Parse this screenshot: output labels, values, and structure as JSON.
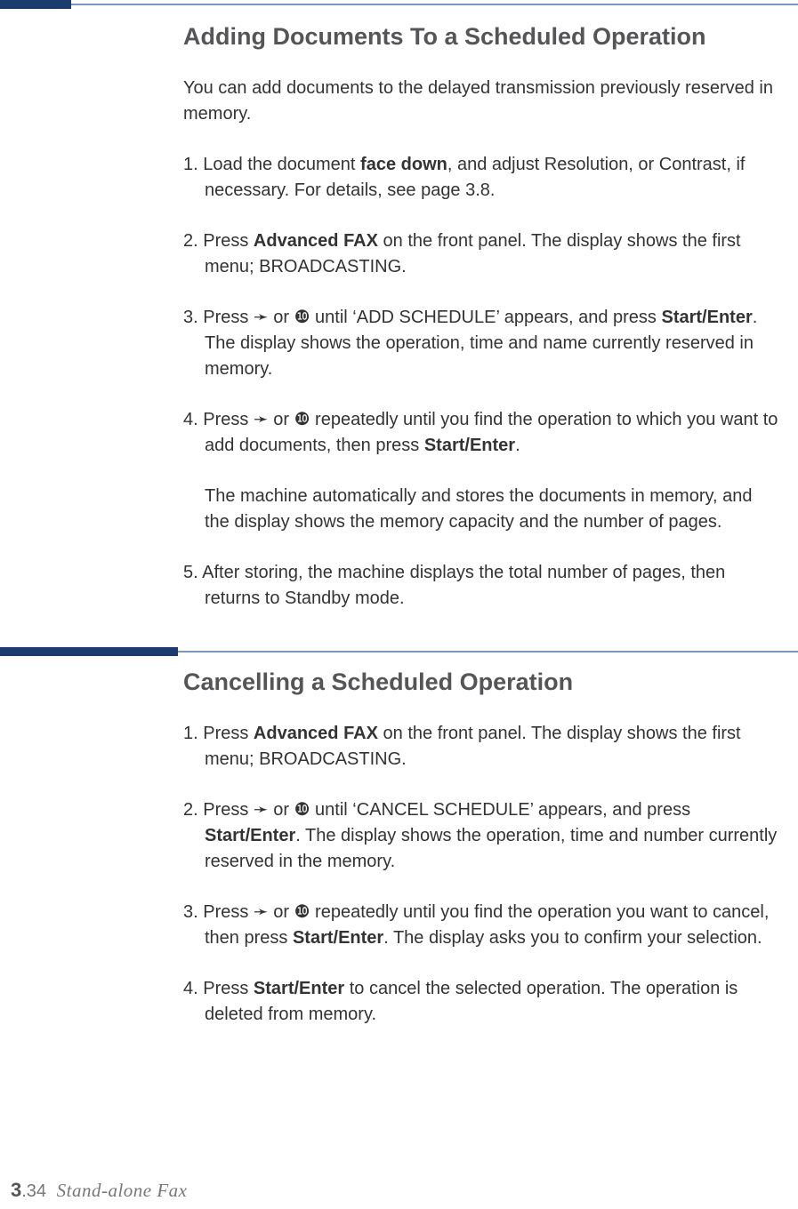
{
  "section1": {
    "title": "Adding Documents To a Scheduled Operation",
    "intro": "You can add documents to the delayed transmission previously reserved in memory.",
    "step1_a": "1. Load the document ",
    "step1_bold": "face down",
    "step1_b": ", and adjust Resolution, or Contrast, if necessary. For details, see page 3.8.",
    "step2_a": "2. Press ",
    "step2_bold": "Advanced FAX",
    "step2_b": " on the front panel. The display shows the first menu; BROADCASTING.",
    "step3_a": "3. Press ➛ or ❿ until ‘ADD SCHEDULE’ appears, and press ",
    "step3_bold": "Start/Enter",
    "step3_b": ". The display shows the operation, time and name currently reserved in memory.",
    "step4_a": "4. Press ➛ or ❿ repeatedly until you find the operation to which you want to add documents, then press ",
    "step4_bold": "Start/Enter",
    "step4_b": ".",
    "step4_cont": "The machine automatically and stores the documents in memory, and the display shows the memory capacity and the number of pages.",
    "step5": "5. After storing, the machine displays the total number of pages, then returns to Standby mode."
  },
  "section2": {
    "title": "Cancelling a Scheduled Operation",
    "step1_a": "1. Press ",
    "step1_bold": "Advanced FAX",
    "step1_b": " on the front panel. The display shows the first menu; BROADCASTING.",
    "step2_a": "2. Press ➛ or ❿ until ‘CANCEL SCHEDULE’ appears, and press ",
    "step2_bold": "Start/Enter",
    "step2_b": ". The display shows the operation, time and number currently reserved in the memory.",
    "step3_a": "3. Press ➛ or ❿ repeatedly until you find the operation you want to cancel, then press ",
    "step3_bold": "Start/Enter",
    "step3_b": ". The display asks you to confirm your selection.",
    "step4_a": "4. Press ",
    "step4_bold": "Start/Enter",
    "step4_b": " to cancel the selected operation. The operation is deleted from memory."
  },
  "footer": {
    "page_major": "3",
    "page_minor": ".34",
    "chapter": "Stand-alone Fax"
  }
}
